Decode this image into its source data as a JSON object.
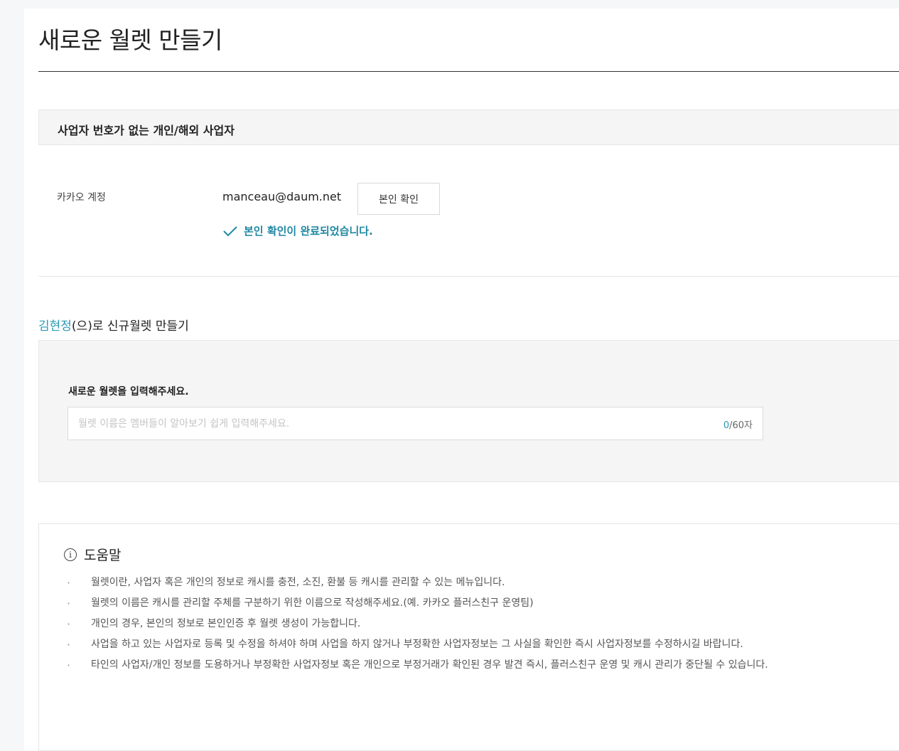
{
  "page": {
    "title": "새로운 월렛 만들기"
  },
  "section": {
    "heading": "사업자 번호가 없는 개인/해외 사업자"
  },
  "account": {
    "label": "카카오 계정",
    "email": "manceau@daum.net",
    "verify_button": "본인 확인",
    "verified_message": "본인 확인이 완료되었습니다."
  },
  "new_wallet": {
    "owner_name": "김현정",
    "heading_suffix": "(으)로 신규월렛 만들기",
    "input_label": "새로운 월렛을 입력해주세요.",
    "input_placeholder": "월렛 이름은 멤버들이 알아보기 쉽게 입력해주세요.",
    "input_value": "",
    "char_count": "0",
    "char_limit": "/60자"
  },
  "help": {
    "icon": "info-icon",
    "title": "도움말",
    "items": [
      "월렛이란, 사업자 혹은 개인의 정보로 캐시를 충전, 소진, 환불 등 캐시를 관리할 수 있는 메뉴입니다.",
      "월렛의 이름은 캐시를 관리할 주체를 구분하기 위한 이름으로 작성해주세요.(예. 카카오 플러스친구 운영팀)",
      "개인의 경우, 본인의 정보로 본인인증 후 월렛 생성이 가능합니다.",
      "사업을 하고 있는 사업자로 등록 및 수정을 하셔야 하며 사업을 하지 않거나 부정확한 사업자정보는 그 사실을 확인한 즉시 사업자정보를 수정하시길 바랍니다.",
      "타인의 사업자/개인 정보를 도용하거나 부정확한 사업자정보 혹은 개인으로 부정거래가 확인된 경우 발견 즉시, 플러스친구 운영 및 캐시 관리가 중단될 수 있습니다."
    ]
  },
  "colors": {
    "accent": "#2a98b5",
    "verified": "#1f88a3",
    "panel_bg": "#f5f5f5"
  }
}
